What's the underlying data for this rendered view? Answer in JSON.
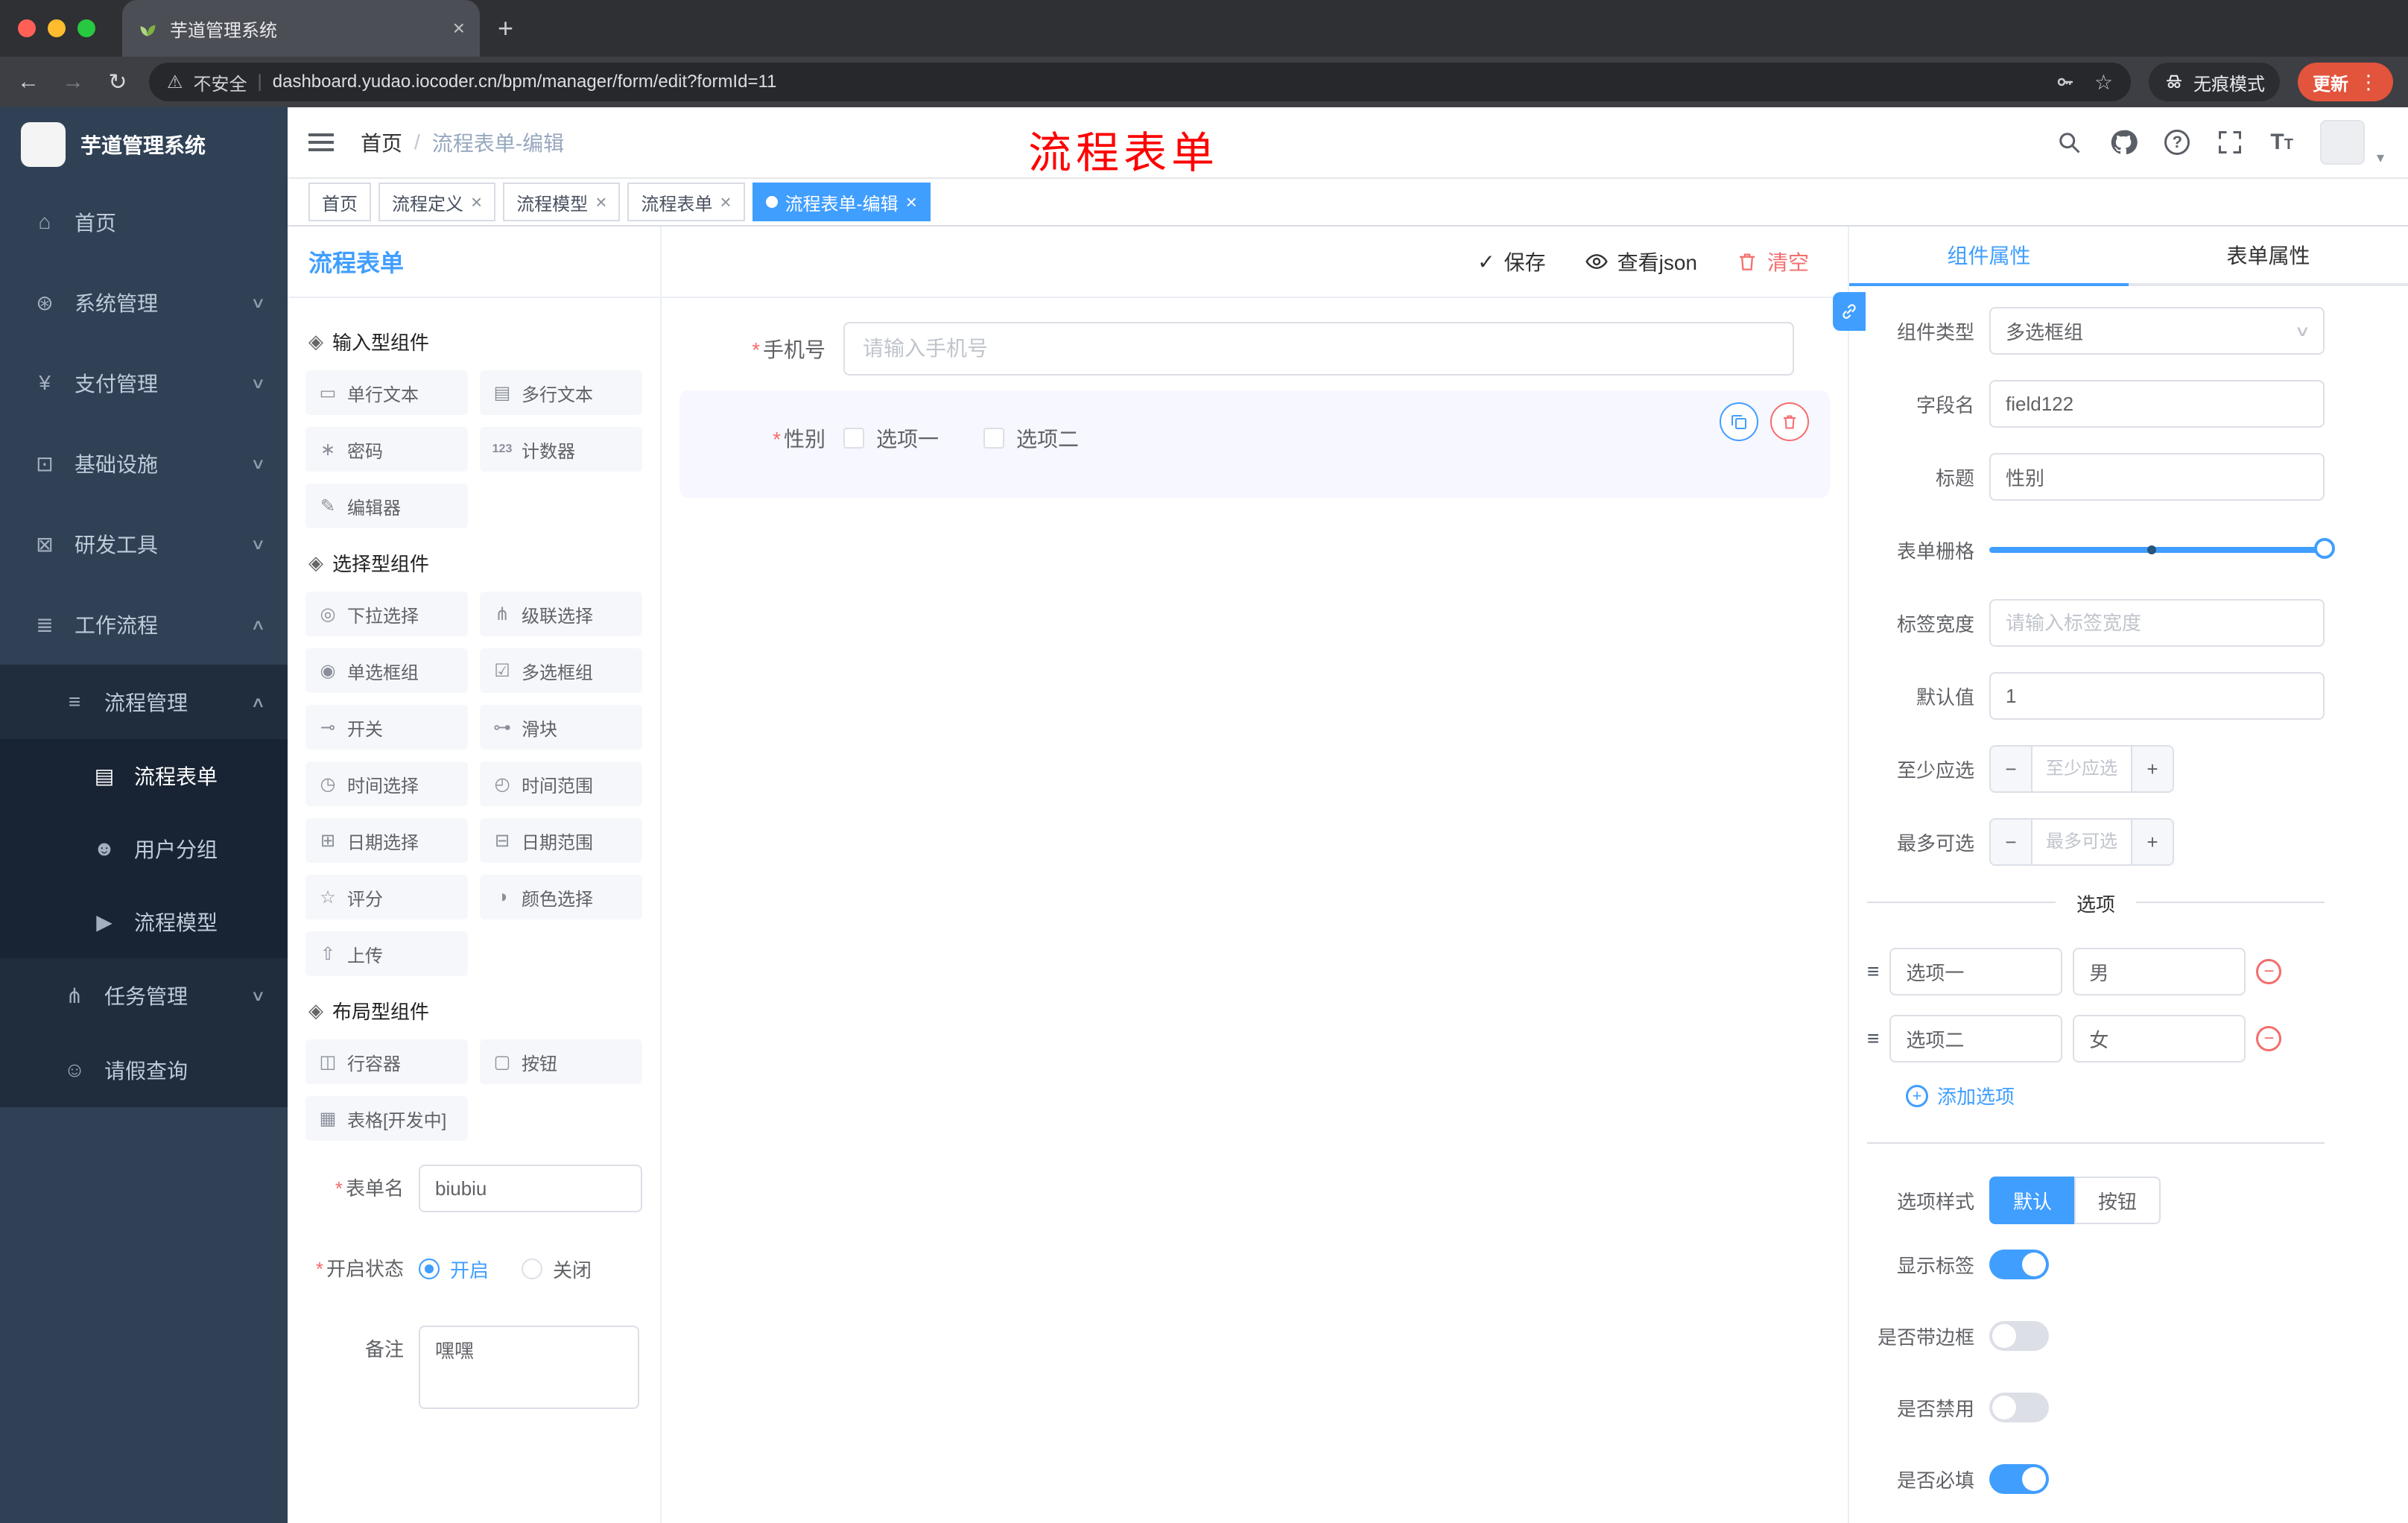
{
  "colors": {
    "accent": "#409EFF",
    "danger": "#F56C6C",
    "banner_red": "#FF0000",
    "sidebar_bg": "#304156"
  },
  "icons": {
    "chevron_down": "∨",
    "chevron_up": "∧",
    "close": "×",
    "dot": "●",
    "plus": "+",
    "minus": "−",
    "check": "✓",
    "drag": "≡",
    "ellipsis": "⋮",
    "back": "←",
    "forward": "→",
    "reload": "↻",
    "warning": "⚠",
    "star": "☆",
    "caret_down": "▾",
    "slash": "/",
    "new_tab": "+",
    "question": "?",
    "pipe": "|",
    "text_size_big": "T",
    "text_size_small": "T"
  },
  "browser": {
    "tab_title": "芋道管理系统",
    "security_label": "不安全",
    "url": "dashboard.yudao.iocoder.cn/bpm/manager/form/edit?formId=11",
    "incognito_label": "无痕模式",
    "update_label": "更新"
  },
  "sidebar": {
    "logo_title": "芋道管理系统",
    "items": [
      {
        "label": "首页",
        "icon": "⌂"
      },
      {
        "label": "系统管理",
        "icon": "⊛"
      },
      {
        "label": "支付管理",
        "icon": "¥"
      },
      {
        "label": "基础设施",
        "icon": "⊡"
      },
      {
        "label": "研发工具",
        "icon": "⊠"
      },
      {
        "label": "工作流程",
        "icon": "≣"
      },
      {
        "label": "流程管理",
        "icon": "≡"
      },
      {
        "label": "流程表单",
        "icon": "▤"
      },
      {
        "label": "用户分组",
        "icon": "☻"
      },
      {
        "label": "流程模型",
        "icon": "▶"
      },
      {
        "label": "任务管理",
        "icon": "⋔"
      },
      {
        "label": "请假查询",
        "icon": "☺"
      }
    ]
  },
  "header": {
    "breadcrumb_home": "首页",
    "breadcrumb_current": "流程表单-编辑",
    "watermark": "流程表单"
  },
  "tags": [
    {
      "label": "首页"
    },
    {
      "label": "流程定义"
    },
    {
      "label": "流程模型"
    },
    {
      "label": "流程表单"
    },
    {
      "label": "流程表单-编辑"
    }
  ],
  "palette": {
    "title": "流程表单",
    "sections": [
      {
        "title": "输入型组件",
        "icon": "◈",
        "items": [
          {
            "label": "单行文本",
            "icon": "▭"
          },
          {
            "label": "多行文本",
            "icon": "▤"
          },
          {
            "label": "密码",
            "icon": "∗"
          },
          {
            "label": "计数器",
            "icon": "123"
          },
          {
            "label": "编辑器",
            "icon": "✎"
          }
        ]
      },
      {
        "title": "选择型组件",
        "icon": "◈",
        "items": [
          {
            "label": "下拉选择",
            "icon": "◎"
          },
          {
            "label": "级联选择",
            "icon": "⋔"
          },
          {
            "label": "单选框组",
            "icon": "◉"
          },
          {
            "label": "多选框组",
            "icon": "☑"
          },
          {
            "label": "开关",
            "icon": "⊸"
          },
          {
            "label": "滑块",
            "icon": "⊶"
          },
          {
            "label": "时间选择",
            "icon": "◷"
          },
          {
            "label": "时间范围",
            "icon": "◴"
          },
          {
            "label": "日期选择",
            "icon": "⊞"
          },
          {
            "label": "日期范围",
            "icon": "⊟"
          },
          {
            "label": "评分",
            "icon": "☆"
          },
          {
            "label": "颜色选择",
            "icon": "◑"
          },
          {
            "label": "上传",
            "icon": "⇧"
          }
        ]
      },
      {
        "title": "布局型组件",
        "icon": "◈",
        "items": [
          {
            "label": "行容器",
            "icon": "◫"
          },
          {
            "label": "按钮",
            "icon": "▢"
          },
          {
            "label": "表格[开发中]",
            "icon": "▦"
          }
        ]
      }
    ],
    "form": {
      "name_label": "表单名",
      "name_value": "biubiu",
      "status_label": "开启状态",
      "status_on": "开启",
      "status_off": "关闭",
      "remark_label": "备注",
      "remark_value": "嘿嘿"
    }
  },
  "canvas": {
    "save_label": "保存",
    "view_json_label": "查看json",
    "clear_label": "清空",
    "fields": [
      {
        "label": "手机号",
        "placeholder": "请输入手机号"
      },
      {
        "label": "性别",
        "option1": "选项一",
        "option2": "选项二"
      }
    ]
  },
  "props": {
    "tab_component": "组件属性",
    "tab_form": "表单属性",
    "component_type_label": "组件类型",
    "component_type_value": "多选框组",
    "field_name_label": "字段名",
    "field_name_value": "field122",
    "title_label": "标题",
    "title_value": "性别",
    "grid_label": "表单栅格",
    "label_width_label": "标签宽度",
    "label_width_placeholder": "请输入标签宽度",
    "default_label": "默认值",
    "default_value": "1",
    "min_label": "至少应选",
    "min_placeholder": "至少应选",
    "max_label": "最多可选",
    "max_placeholder": "最多可选",
    "options_title": "选项",
    "options": [
      {
        "label": "选项一",
        "value": "男"
      },
      {
        "label": "选项二",
        "value": "女"
      }
    ],
    "add_option_label": "添加选项",
    "style_label": "选项样式",
    "style_default": "默认",
    "style_button": "按钮",
    "show_label_label": "显示标签",
    "border_label": "是否带边框",
    "disabled_label": "是否禁用",
    "required_label": "是否必填"
  }
}
